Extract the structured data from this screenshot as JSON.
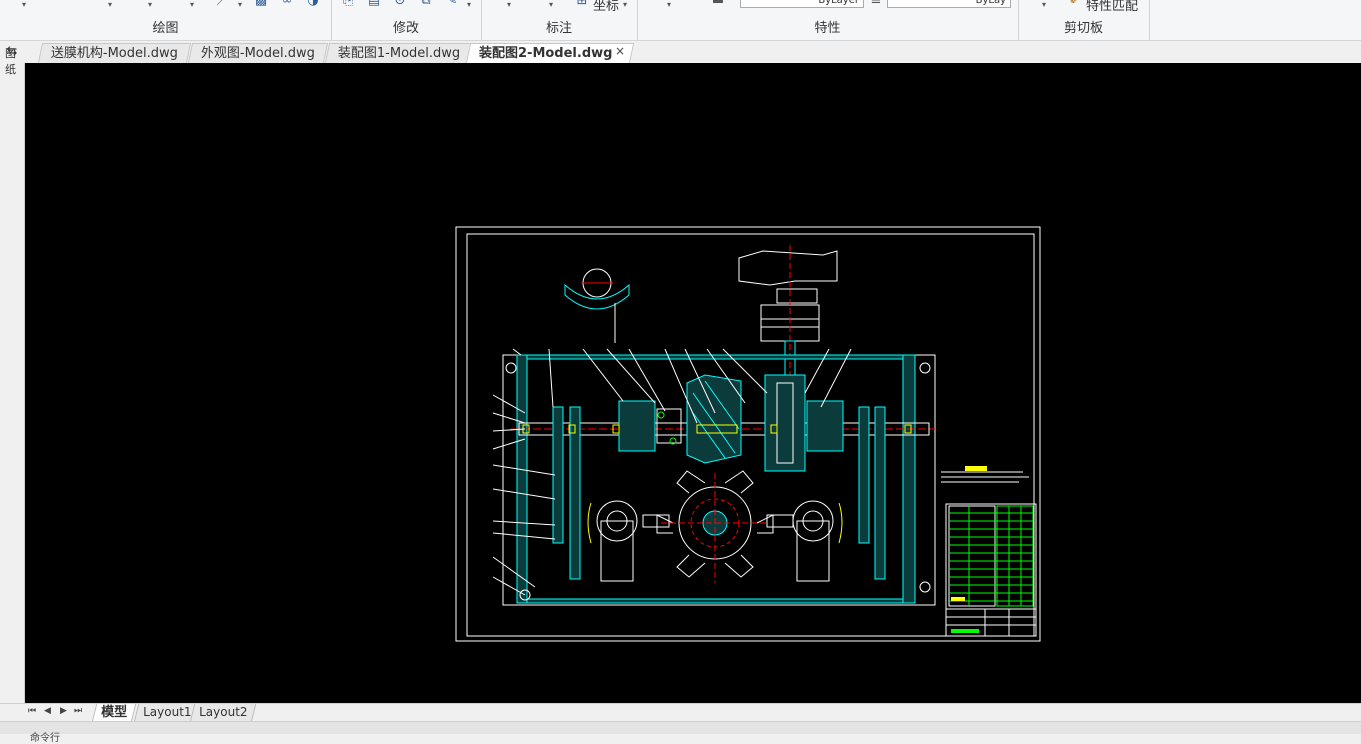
{
  "ribbon": {
    "panels": [
      {
        "label": "绘图"
      },
      {
        "label": "修改"
      },
      {
        "label": "标注"
      },
      {
        "label": "特性"
      },
      {
        "label": "剪切板"
      }
    ],
    "annotation_coord_label": "坐标",
    "layer_dropdown_value": "ByLayer",
    "linetype_dropdown_value": "ByLay",
    "match_properties_label": "特性匹配"
  },
  "doc_tabs": [
    {
      "label": "送膜机构-Model.dwg",
      "active": false
    },
    {
      "label": "外观图-Model.dwg",
      "active": false
    },
    {
      "label": "装配图1-Model.dwg",
      "active": false
    },
    {
      "label": "装配图2-Model.dwg",
      "active": true
    }
  ],
  "tab_close_glyph": "×",
  "left_strip": {
    "label": "图纸"
  },
  "layout_tabs": [
    {
      "label": "模型",
      "active": true
    },
    {
      "label": "Layout1",
      "active": false
    },
    {
      "label": "Layout2",
      "active": false
    }
  ],
  "nav_arrows": [
    "⏮",
    "◀",
    "▶",
    "⏭"
  ],
  "command_line_text": "命令行",
  "colors": {
    "canvas_bg": "#000000",
    "cad_white": "#ffffff",
    "cad_cyan": "#00ffff",
    "cad_red": "#ff0000",
    "cad_green": "#00ff00",
    "cad_yellow": "#ffff00",
    "cad_magenta": "#ff00ff"
  },
  "icons": [
    "draw-tool-icons",
    "modify-tool-icons",
    "dimension-icons",
    "clipboard-icon",
    "ucs-icon"
  ]
}
